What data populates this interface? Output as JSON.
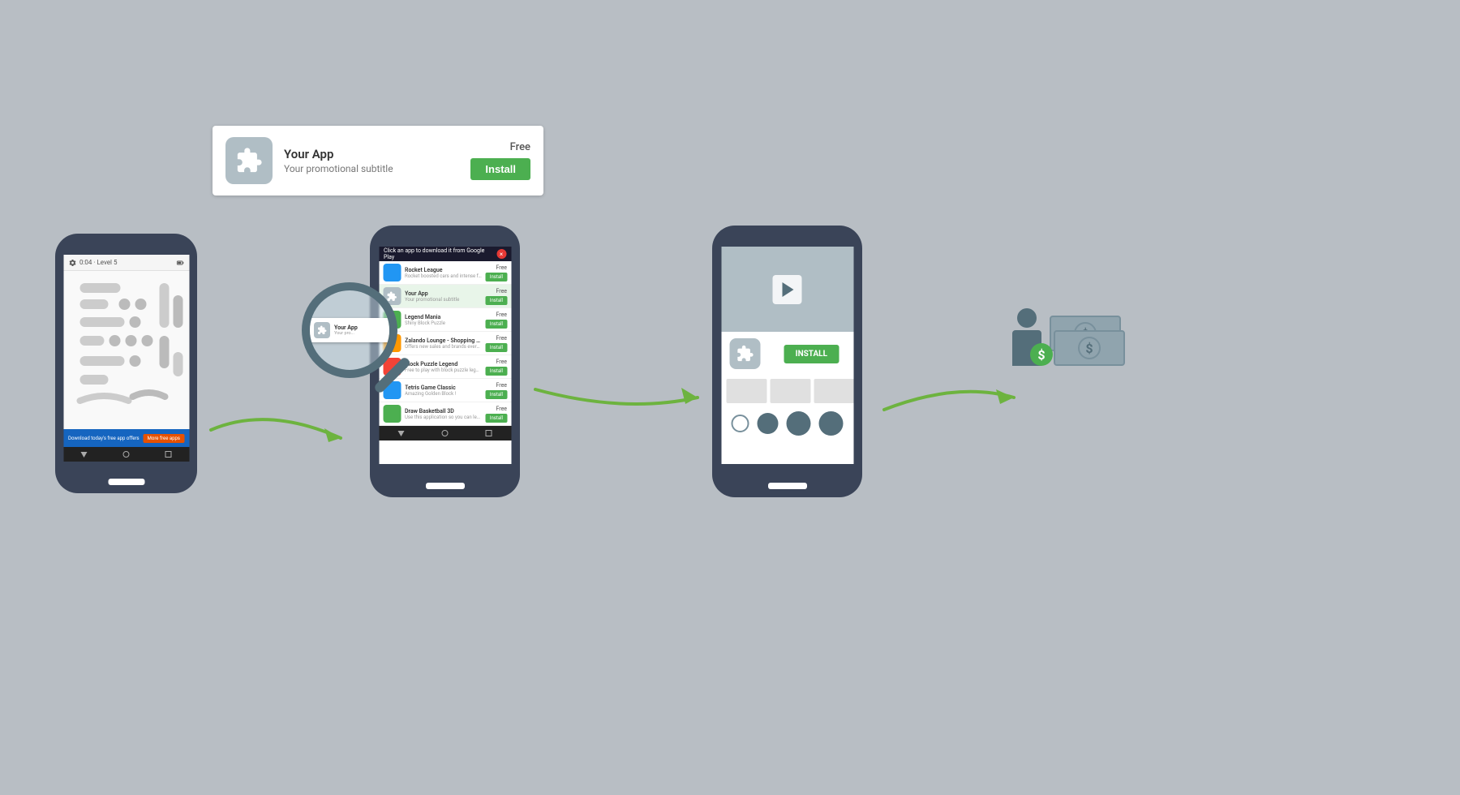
{
  "background_color": "#b8bec4",
  "ad_banner": {
    "app_name": "Your App",
    "subtitle": "Your promotional subtitle",
    "price": "Free",
    "install_label": "Install"
  },
  "phone1": {
    "status": "0:04 · Level 5",
    "banner_text": "Download today's free app offers",
    "banner_btn": "More free apps"
  },
  "phone2": {
    "status_text": "Click an app to download it from Google Play",
    "apps": [
      {
        "name": "Rocket League",
        "sub": "Rocket boosted cars and intense fun and action",
        "price": "Free",
        "install": "Install"
      },
      {
        "name": "Your App",
        "sub": "Your promotional subtitle",
        "price": "Free",
        "install": "Install",
        "highlight": true
      },
      {
        "name": "Legend Mania",
        "sub": "Shiny Block Puzzle",
        "price": "Free",
        "install": "Install"
      },
      {
        "name": "Zalando Lounge - Shopping Club",
        "sub": "Offers new sales and brands every day",
        "price": "Free",
        "install": "Install"
      },
      {
        "name": "Block Puzzle Legend",
        "sub": "Free to play with block puzzle legend, xmas games",
        "price": "Free",
        "install": "Install"
      },
      {
        "name": "Tetris Game Classic",
        "sub": "Amazing Golden Block !",
        "price": "Free",
        "install": "Install"
      },
      {
        "name": "Draw Basketball 3D",
        "sub": "Use this application so you can learn how",
        "price": "Free",
        "install": "Install"
      }
    ]
  },
  "phone3": {
    "install_label": "INSTALL"
  },
  "revenue": {
    "dollar_sign": "$",
    "badge_sign": "$"
  },
  "arrows": [
    "phone1_to_phone2",
    "phone2_to_phone3",
    "phone3_to_revenue"
  ]
}
